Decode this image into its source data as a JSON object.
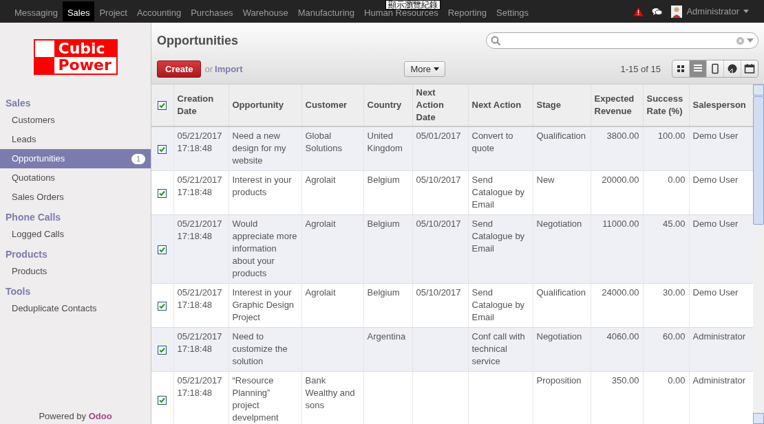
{
  "top_menu": {
    "items": [
      {
        "label": "Messaging",
        "selected": false
      },
      {
        "label": "Sales",
        "selected": true
      },
      {
        "label": "Project",
        "selected": false
      },
      {
        "label": "Accounting",
        "selected": false
      },
      {
        "label": "Purchases",
        "selected": false
      },
      {
        "label": "Warehouse",
        "selected": false
      },
      {
        "label": "Manufacturing",
        "selected": false
      },
      {
        "label": "Human Resources",
        "selected": false
      },
      {
        "label": "Reporting",
        "selected": false
      },
      {
        "label": "Settings",
        "selected": false
      }
    ],
    "tooltip": "顯示瀏覽紀錄",
    "user": "Administrator"
  },
  "sidebar": {
    "logo": [
      "Cubic",
      "Power"
    ],
    "sections": [
      {
        "title": "Sales",
        "items": [
          {
            "label": "Customers",
            "selected": false
          },
          {
            "label": "Leads",
            "selected": false
          },
          {
            "label": "Opportunities",
            "selected": true,
            "badge": "1"
          },
          {
            "label": "Quotations",
            "selected": false
          },
          {
            "label": "Sales Orders",
            "selected": false
          }
        ]
      },
      {
        "title": "Phone Calls",
        "items": [
          {
            "label": "Logged Calls",
            "selected": false
          }
        ]
      },
      {
        "title": "Products",
        "items": [
          {
            "label": "Products",
            "selected": false
          }
        ]
      },
      {
        "title": "Tools",
        "items": [
          {
            "label": "Deduplicate Contacts",
            "selected": false
          }
        ]
      }
    ],
    "footer": {
      "text": "Powered by",
      "brand": "Odoo"
    }
  },
  "header": {
    "title": "Opportunities",
    "create": "Create",
    "or": "or",
    "import": "Import",
    "more": "More",
    "pager": "1-15 of 15",
    "views": [
      {
        "kind": "kanban",
        "selected": false
      },
      {
        "kind": "list",
        "selected": true
      },
      {
        "kind": "form",
        "selected": false
      },
      {
        "kind": "graph",
        "selected": false
      },
      {
        "kind": "calendar",
        "selected": false
      }
    ]
  },
  "table": {
    "all_checked": true,
    "columns": [
      "Creation Date",
      "Opportunity",
      "Customer",
      "Country",
      "Next Action Date",
      "Next Action",
      "Stage",
      "Expected Revenue",
      "Success Rate (%)",
      "Salesperson"
    ],
    "rows": [
      {
        "checked": true,
        "cells": [
          "05/21/2017 17:18:48",
          "Need a new design for my website",
          "Global Solutions",
          "United Kingdom",
          "05/01/2017",
          "Convert to quote",
          "Qualification",
          "3800.00",
          "100.00",
          "Demo User"
        ]
      },
      {
        "checked": true,
        "cells": [
          "05/21/2017 17:18:48",
          "Interest in your products",
          "Agrolait",
          "Belgium",
          "05/10/2017",
          "Send Catalogue by Email",
          "New",
          "20000.00",
          "0.00",
          "Demo User"
        ]
      },
      {
        "checked": true,
        "cells": [
          "05/21/2017 17:18:48",
          "Would appreciate more information about your products",
          "Agrolait",
          "Belgium",
          "05/10/2017",
          "Send Catalogue by Email",
          "Negotiation",
          "11000.00",
          "45.00",
          "Demo User"
        ]
      },
      {
        "checked": true,
        "cells": [
          "05/21/2017 17:18:48",
          "Interest in your Graphic Design Project",
          "Agrolait",
          "Belgium",
          "05/10/2017",
          "Send Catalogue by Email",
          "Qualification",
          "24000.00",
          "30.00",
          "Demo User"
        ]
      },
      {
        "checked": true,
        "cells": [
          "05/21/2017 17:18:48",
          "Need to customize the solution",
          "",
          "Argentina",
          "",
          "Conf call with technical service",
          "Negotiation",
          "4060.00",
          "60.00",
          "Administrator"
        ]
      },
      {
        "checked": true,
        "cells": [
          "05/21/2017 17:18:48",
          "“Resource Planning” project develpment",
          "Bank Wealthy and sons",
          "",
          "",
          "",
          "Proposition",
          "350.00",
          "0.00",
          "Administrator"
        ]
      }
    ]
  }
}
